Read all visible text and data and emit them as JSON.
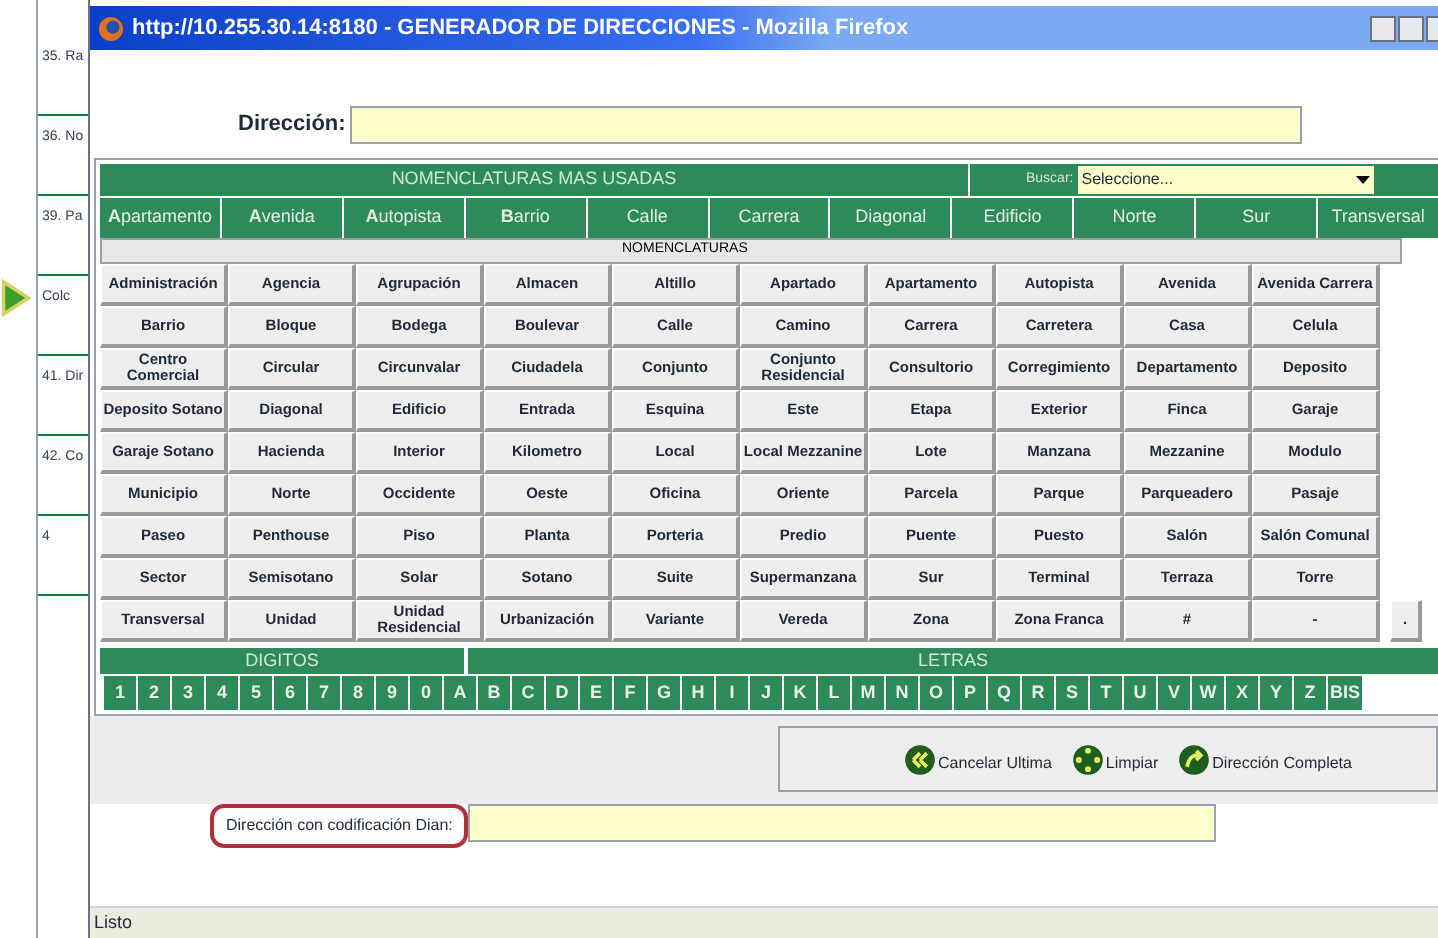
{
  "background_list": {
    "items": [
      "35. Ra",
      "36. No",
      "39. Pa",
      "Colc",
      "41. Dir",
      "42. Co",
      "4"
    ]
  },
  "window": {
    "title": "http://10.255.30.14:8180 - GENERADOR DE DIRECCIONES - Mozilla Firefox"
  },
  "address_field": {
    "label": "Dirección:"
  },
  "most_used": {
    "title": "NOMENCLATURAS MAS USADAS",
    "search_label": "Buscar:",
    "search_value": "Seleccione...",
    "buttons": [
      "**A**partamento",
      "**A**venida",
      "**A**utopista",
      "**B**arrio",
      "Calle",
      "Carrera",
      "Diagonal",
      "Edificio",
      "Norte",
      "Sur",
      "Transversal"
    ]
  },
  "nomenclatures": {
    "title": "NOMENCLATURAS",
    "rows": [
      [
        "Administración",
        "Agencia",
        "Agrupación",
        "Almacen",
        "Altillo",
        "Apartado",
        "Apartamento",
        "Autopista",
        "Avenida",
        "Avenida Carrera"
      ],
      [
        "Barrio",
        "Bloque",
        "Bodega",
        "Boulevar",
        "Calle",
        "Camino",
        "Carrera",
        "Carretera",
        "Casa",
        "Celula"
      ],
      [
        "Centro Comercial",
        "Circular",
        "Circunvalar",
        "Ciudadela",
        "Conjunto",
        "Conjunto Residencial",
        "Consultorio",
        "Corregimiento",
        "Departamento",
        "Deposito"
      ],
      [
        "Deposito Sotano",
        "Diagonal",
        "Edificio",
        "Entrada",
        "Esquina",
        "Este",
        "Etapa",
        "Exterior",
        "Finca",
        "Garaje"
      ],
      [
        "Garaje Sotano",
        "Hacienda",
        "Interior",
        "Kilometro",
        "Local",
        "Local Mezzanine",
        "Lote",
        "Manzana",
        "Mezzanine",
        "Modulo"
      ],
      [
        "Municipio",
        "Norte",
        "Occidente",
        "Oeste",
        "Oficina",
        "Oriente",
        "Parcela",
        "Parque",
        "Parqueadero",
        "Pasaje"
      ],
      [
        "Paseo",
        "Penthouse",
        "Piso",
        "Planta",
        "Porteria",
        "Predio",
        "Puente",
        "Puesto",
        "Salón",
        "Salón Comunal"
      ],
      [
        "Sector",
        "Semisotano",
        "Solar",
        "Sotano",
        "Suite",
        "Supermanzana",
        "Sur",
        "Terminal",
        "Terraza",
        "Torre"
      ],
      [
        "Transversal",
        "Unidad",
        "Unidad Residencial",
        "Urbanización",
        "Variante",
        "Vereda",
        "Zona",
        "Zona Franca",
        "#",
        "-",
        "."
      ]
    ]
  },
  "digits": {
    "title": "DIGITOS",
    "keys": [
      "1",
      "2",
      "3",
      "4",
      "5",
      "6",
      "7",
      "8",
      "9",
      "0"
    ]
  },
  "letters": {
    "title": "LETRAS",
    "keys": [
      "A",
      "B",
      "C",
      "D",
      "E",
      "F",
      "G",
      "H",
      "I",
      "J",
      "K",
      "L",
      "M",
      "N",
      "O",
      "P",
      "Q",
      "R",
      "S",
      "T",
      "U",
      "V",
      "W",
      "X",
      "Y",
      "Z",
      "BIS"
    ]
  },
  "actions": [
    {
      "label": "Cancelar Ultima",
      "kind": "back"
    },
    {
      "label": "Limpiar",
      "kind": "clear"
    },
    {
      "label": "Dirección Completa",
      "kind": "complete"
    }
  ],
  "dian_field": {
    "label": "Dirección con codificación Dian:"
  },
  "status_bar": "Listo"
}
